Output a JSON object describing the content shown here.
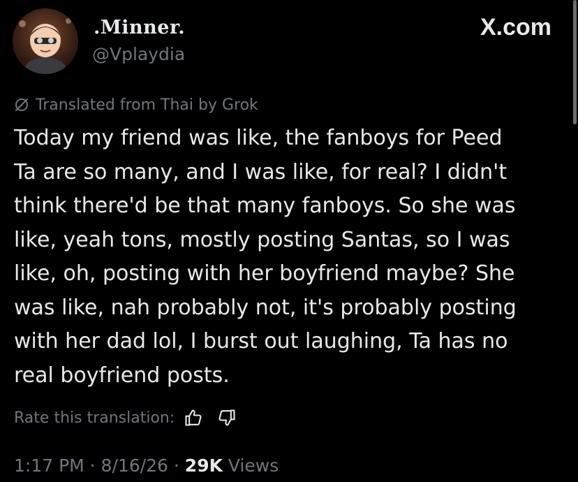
{
  "author": {
    "display_name": ".Minner.",
    "handle": "@Vplaydia",
    "avatar_icon": "cartoon-character-avatar"
  },
  "brand": {
    "label": "X.com"
  },
  "translation": {
    "icon": "translate-icon",
    "notice": "Translated from Thai by Grok"
  },
  "tweet": {
    "lines": [
      "Today my friend was like, the fanboys for Peed",
      "Ta are so many, and I was like, for real? I didn't",
      "think there'd be that many fanboys. So she was",
      "like, yeah tons, mostly posting Santas, so I was",
      "like, oh, posting with her boyfriend maybe? She",
      "was like, nah probably not, it's probably posting",
      "with her dad lol, I burst out laughing, Ta has no",
      "real boyfriend posts."
    ]
  },
  "rating": {
    "label": "Rate this translation:",
    "thumbs_up_icon": "thumbs-up-icon",
    "thumbs_down_icon": "thumbs-down-icon"
  },
  "meta": {
    "time": "1:17 PM",
    "separator": " · ",
    "date": "8/16/26",
    "views_count": "29K",
    "views_label": "Views"
  },
  "colors": {
    "background": "#000000",
    "primary_text": "#e7e9ea",
    "secondary_text": "#71767b"
  }
}
